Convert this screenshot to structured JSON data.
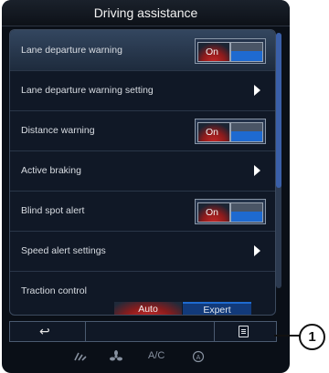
{
  "title": "Driving assistance",
  "rows": [
    {
      "label": "Lane departure warning",
      "control": "toggle",
      "state": "On"
    },
    {
      "label": "Lane departure warning setting",
      "control": "submenu"
    },
    {
      "label": "Distance warning",
      "control": "toggle",
      "state": "On"
    },
    {
      "label": "Active braking",
      "control": "submenu"
    },
    {
      "label": "Blind spot alert",
      "control": "toggle",
      "state": "On"
    },
    {
      "label": "Speed alert settings",
      "control": "submenu"
    },
    {
      "label": "Traction control",
      "control": "segmented",
      "options": [
        "Auto",
        "Expert"
      ],
      "selected": "Auto"
    }
  ],
  "bottom": {
    "back_icon": "back-arrow-icon",
    "menu_icon": "menu-icon"
  },
  "climate": {
    "fan_speed_icon": "fan-speed-icon",
    "fan_icon": "fan-icon",
    "ac_label": "A/C",
    "auto_icon": "auto-climate-icon"
  },
  "callout": "1",
  "colors": {
    "on_red": "#c62828",
    "blue": "#1e6ad0",
    "panel": "#101826"
  }
}
